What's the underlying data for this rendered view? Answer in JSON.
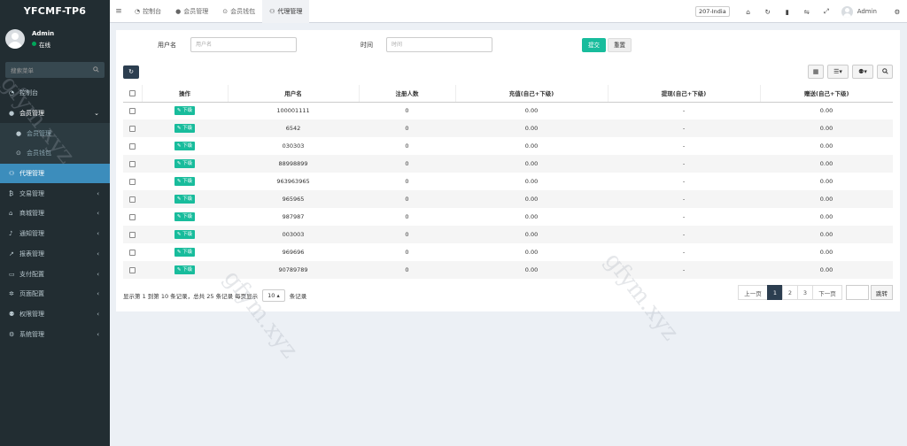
{
  "app": {
    "logo": "YFCMF-TP6"
  },
  "user": {
    "name": "Admin",
    "status": "在线"
  },
  "sidebar": {
    "search_placeholder": "搜索菜单",
    "items": [
      {
        "label": "控制台",
        "icon": "dashboard-icon"
      },
      {
        "label": "会员管理",
        "icon": "user-icon",
        "open": true
      },
      {
        "label": "会员管理",
        "icon": "user-icon",
        "sub": true
      },
      {
        "label": "会员钱包",
        "icon": "wallet-icon",
        "sub": true
      },
      {
        "label": "代理管理",
        "icon": "sitemap-icon",
        "active": true
      },
      {
        "label": "交易管理",
        "icon": "bitcoin-icon"
      },
      {
        "label": "商城管理",
        "icon": "home-icon"
      },
      {
        "label": "通知管理",
        "icon": "bell-icon"
      },
      {
        "label": "报表管理",
        "icon": "chart-icon"
      },
      {
        "label": "支付配置",
        "icon": "card-icon"
      },
      {
        "label": "页面配置",
        "icon": "gear-icon"
      },
      {
        "label": "权限管理",
        "icon": "users-icon"
      },
      {
        "label": "系统管理",
        "icon": "cogs-icon"
      }
    ]
  },
  "topbar": {
    "tabs": [
      {
        "label": "控制台",
        "icon": "dashboard-icon"
      },
      {
        "label": "会员管理",
        "icon": "user-icon"
      },
      {
        "label": "会员钱包",
        "icon": "wallet-icon"
      },
      {
        "label": "代理管理",
        "icon": "sitemap-icon",
        "active": true
      }
    ],
    "language": "207-India",
    "admin": "Admin"
  },
  "filter": {
    "username_label": "用户名",
    "username_placeholder": "用户名",
    "time_label": "时间",
    "time_placeholder": "时间",
    "submit": "提交",
    "reset": "重置"
  },
  "table": {
    "headers": [
      "操作",
      "用户名",
      "注册人数",
      "充值(自己+下级)",
      "提现(自己+下级)",
      "赠送(自己+下级)"
    ],
    "action_label": "下级",
    "rows": [
      {
        "username": "100001111",
        "reg": "0",
        "recharge": "0.00",
        "withdraw": "-",
        "gift": "0.00"
      },
      {
        "username": "6542",
        "reg": "0",
        "recharge": "0.00",
        "withdraw": "-",
        "gift": "0.00"
      },
      {
        "username": "030303",
        "reg": "0",
        "recharge": "0.00",
        "withdraw": "-",
        "gift": "0.00"
      },
      {
        "username": "88998899",
        "reg": "0",
        "recharge": "0.00",
        "withdraw": "-",
        "gift": "0.00"
      },
      {
        "username": "963963965",
        "reg": "0",
        "recharge": "0.00",
        "withdraw": "-",
        "gift": "0.00"
      },
      {
        "username": "965965",
        "reg": "0",
        "recharge": "0.00",
        "withdraw": "-",
        "gift": "0.00"
      },
      {
        "username": "987987",
        "reg": "0",
        "recharge": "0.00",
        "withdraw": "-",
        "gift": "0.00"
      },
      {
        "username": "003003",
        "reg": "0",
        "recharge": "0.00",
        "withdraw": "-",
        "gift": "0.00"
      },
      {
        "username": "969696",
        "reg": "0",
        "recharge": "0.00",
        "withdraw": "-",
        "gift": "0.00"
      },
      {
        "username": "90789789",
        "reg": "0",
        "recharge": "0.00",
        "withdraw": "-",
        "gift": "0.00"
      }
    ]
  },
  "footer": {
    "info_prefix": "显示第 1 到第 10 条记录，总共 25 条记录 每页显示",
    "page_size": "10",
    "info_suffix": "条记录",
    "prev": "上一页",
    "pages": [
      "1",
      "2",
      "3"
    ],
    "current_page": "1",
    "next": "下一页",
    "jump": "跳转"
  },
  "watermark": "gfym.xyz",
  "colors": {
    "sidebar": "#222d32",
    "active": "#3c8dbc",
    "primary": "#18bc9c",
    "dark": "#2c3e50"
  }
}
